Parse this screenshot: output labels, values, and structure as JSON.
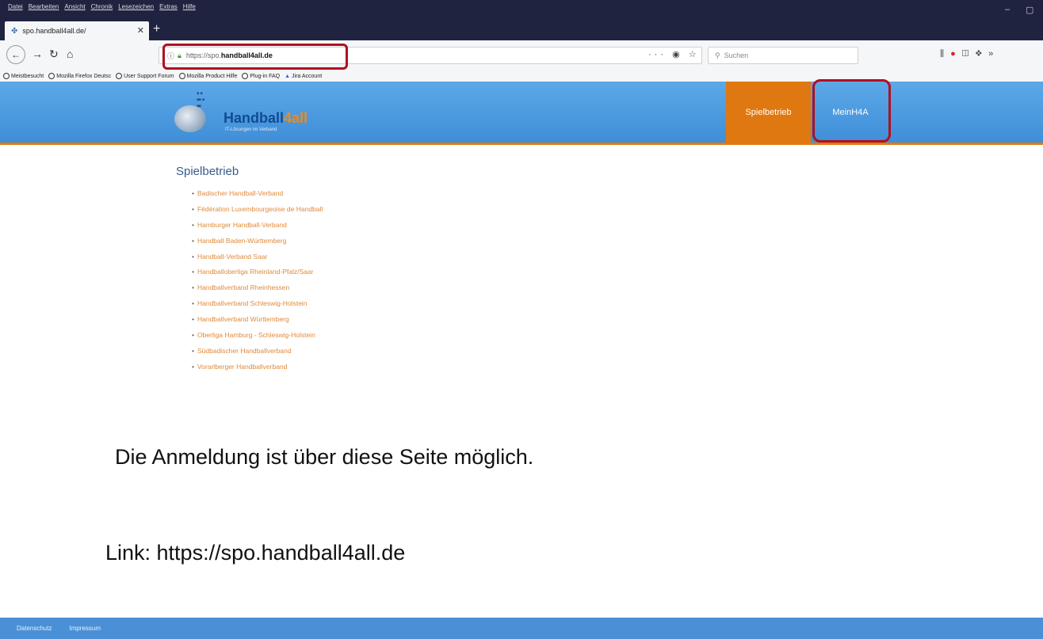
{
  "browser": {
    "menu": [
      "Datei",
      "Bearbeiten",
      "Ansicht",
      "Chronik",
      "Lesezeichen",
      "Extras",
      "Hilfe"
    ],
    "tab_title": "spo.handball4all.de/",
    "url_scheme": "https://spo.",
    "url_host": "handball4all.de",
    "search_placeholder": "Suchen",
    "bookmarks": [
      "Meistbesucht",
      "Mozilla Firefox Deutsc",
      "User Support Forum",
      "Mozilla Product Hilfe",
      "Plug-in FAQ",
      "Jira Account"
    ]
  },
  "site": {
    "logo_text_main": "Handball",
    "logo_text_accent": "4all",
    "logo_tagline": "IT-Lösungen im Verband",
    "nav": [
      "Spielbetrieb",
      "MeinH4A"
    ]
  },
  "content": {
    "heading": "Spielbetrieb",
    "associations": [
      "Badischer Handball-Verband",
      "Fédération Luxembourgeoise de Handball",
      "Hamburger Handball-Verband",
      "Handball Baden-Württemberg",
      "Handball-Verband Saar",
      "Handballoberliga Rheinland-Pfalz/Saar",
      "Handballverband Rheinhessen",
      "Handballverband Schleswig-Holstein",
      "Handballverband Württemberg",
      "Oberliga Hamburg - Schleswig-Holstein",
      "Südbadischer Handballverband",
      "Vorarlberger Handballverband"
    ]
  },
  "annotation": {
    "info": "Die Anmeldung ist über diese Seite möglich.",
    "link": "Link: https://spo.handball4all.de"
  },
  "footer": [
    "Datenschutz",
    "Impressum"
  ],
  "colors": {
    "header_blue": "#4a9ae0",
    "nav_orange": "#e07812",
    "highlight_red": "#b01020",
    "link_orange": "#e08a3a"
  }
}
